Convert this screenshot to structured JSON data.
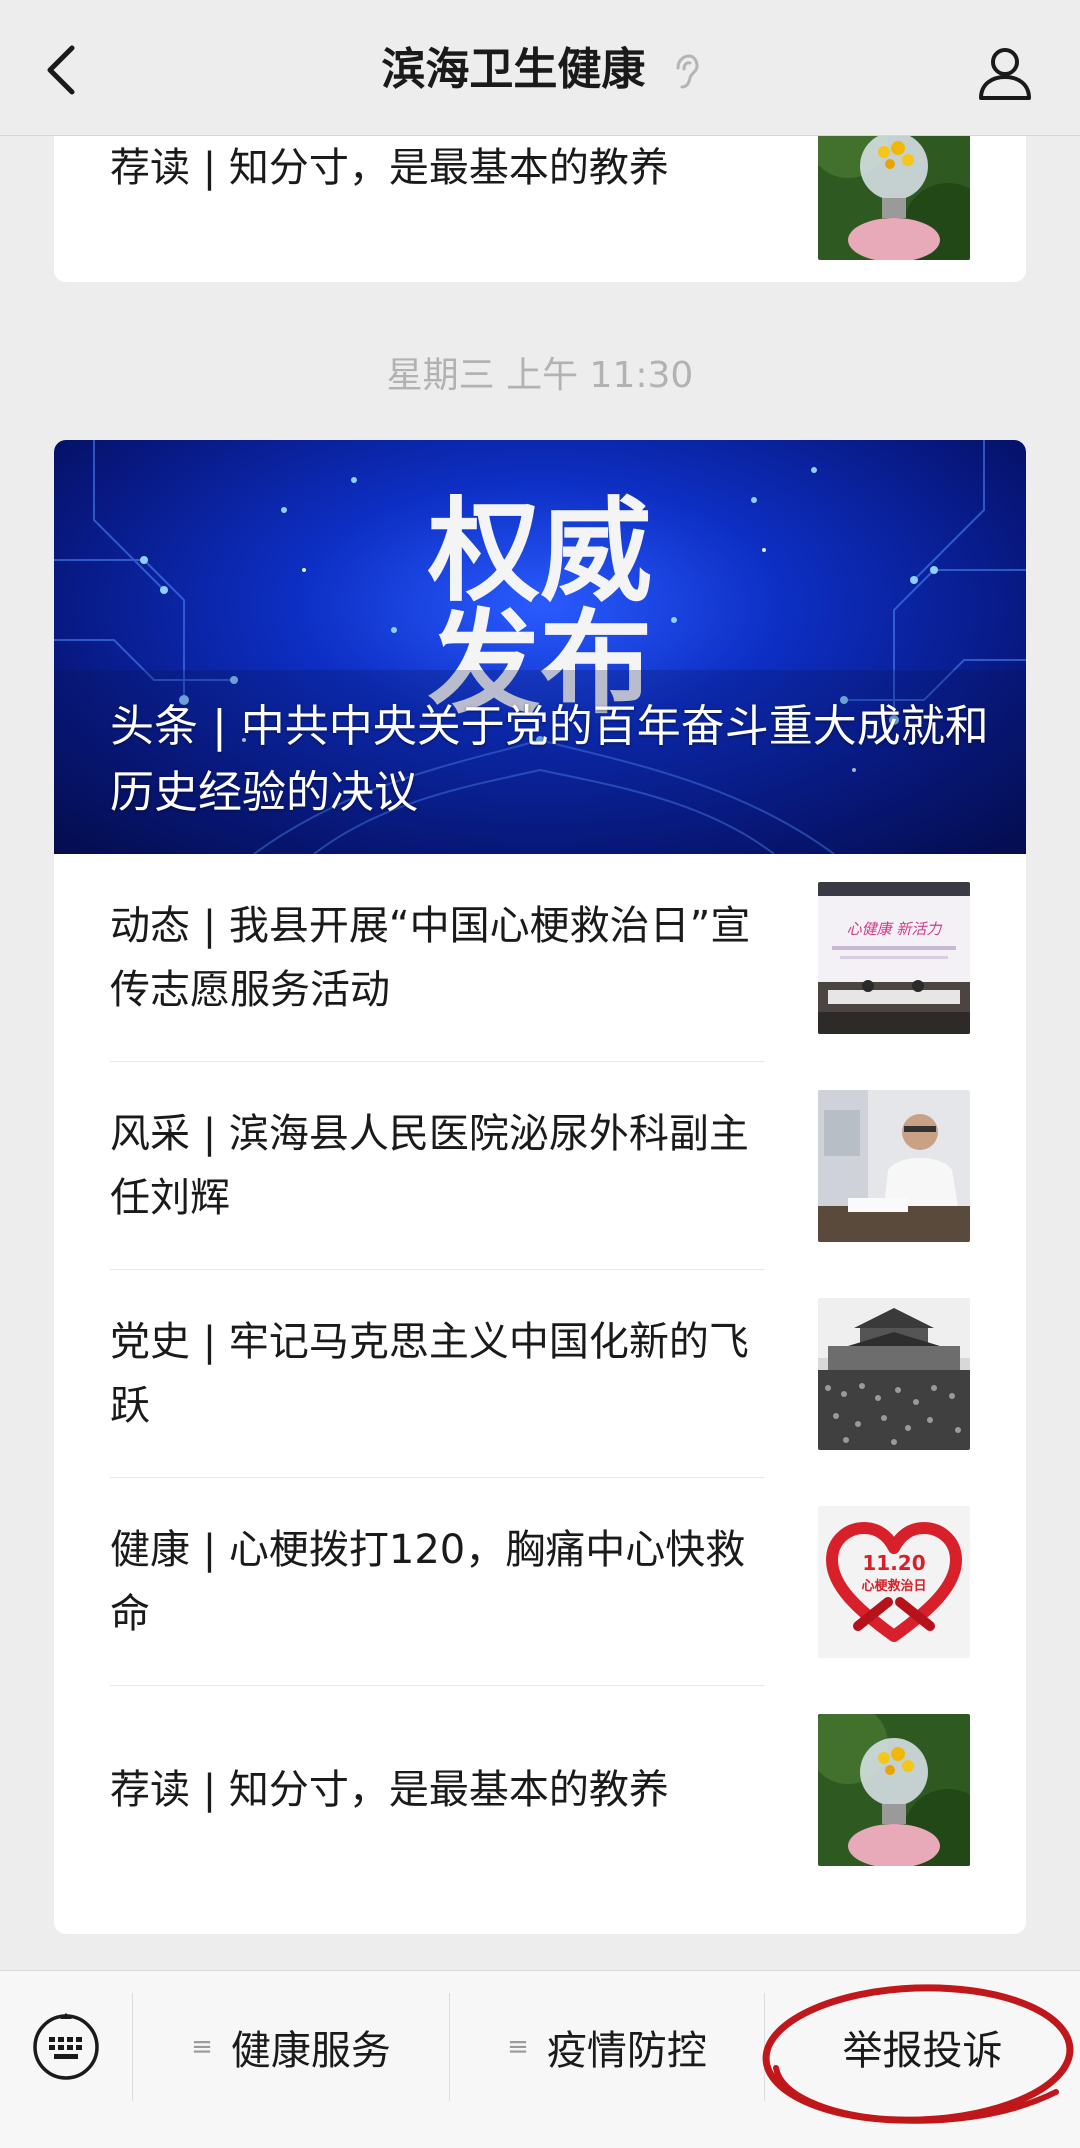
{
  "header": {
    "title": "滨海卫生健康",
    "back_icon": "chevron-left-icon",
    "ear_icon": "ear-icon",
    "profile_icon": "user-profile-icon"
  },
  "feed": {
    "top_card": {
      "title": "荐读 | 知分寸，是最基本的教养",
      "thumb": "lightbulb-flowers-image"
    },
    "timestamp": "星期三 上午 11:30",
    "main_card": {
      "cover_text_line1": "权威",
      "cover_text_line2": "发布",
      "headline": "头条 | 中共中央关于党的百年奋斗重大成就和历史经验的决议",
      "items": [
        {
          "title": "动态 | 我县开展“中国心梗救治日”宣传志愿服务活动",
          "thumb": "conference-image",
          "thumb_caption": "心健康  新活力"
        },
        {
          "title": "风采 | 滨海县人民医院泌尿外科副主任刘辉",
          "thumb": "doctor-portrait-image"
        },
        {
          "title": "党史 | 牢记马克思主义中国化新的飞跃",
          "thumb": "tiananmen-photo-image"
        },
        {
          "title": "健康 | 心梗拨打120，胸痛中心快救命",
          "thumb": "heart-ribbon-image",
          "thumb_line1": "11.20",
          "thumb_line2": "心梗救治日"
        },
        {
          "title": "荐读 | 知分寸，是最基本的教养",
          "thumb": "lightbulb-flowers-image"
        }
      ]
    }
  },
  "menu": {
    "keyboard_icon": "keyboard-icon",
    "items": [
      {
        "label": "健康服务",
        "has_submenu": true
      },
      {
        "label": "疫情防控",
        "has_submenu": true
      },
      {
        "label": "举报投诉",
        "has_submenu": false
      }
    ],
    "highlight_color": "#c0171b"
  }
}
